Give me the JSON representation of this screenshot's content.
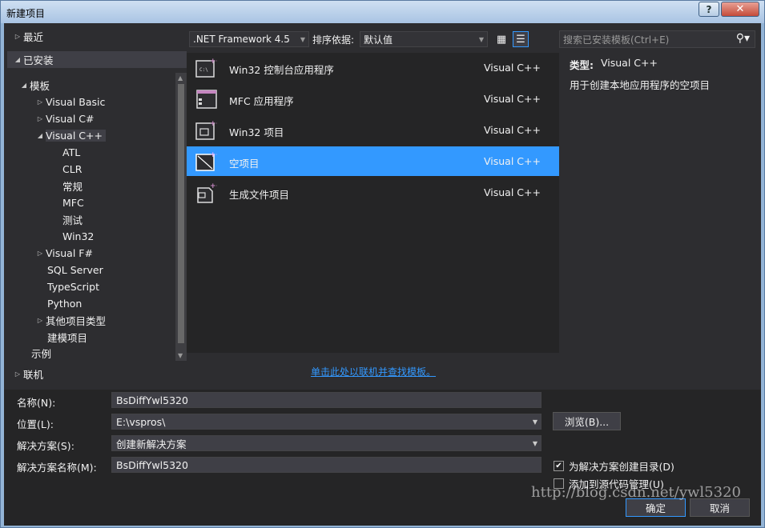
{
  "window": {
    "title": "新建项目",
    "help": "?",
    "close": "✕"
  },
  "nav": {
    "recent": "最近",
    "installed": "已安装",
    "templates": "模板",
    "items": [
      "Visual Basic",
      "Visual C#",
      "Visual C++"
    ],
    "cpp_children": [
      "ATL",
      "CLR",
      "常规",
      "MFC",
      "测试",
      "Win32"
    ],
    "items2": [
      "Visual F#",
      "SQL Server",
      "TypeScript",
      "Python",
      "其他项目类型",
      "建模项目"
    ],
    "samples": "示例",
    "online": "联机"
  },
  "toolbar": {
    "framework": ".NET Framework 4.5",
    "sort_label": "排序依据:",
    "sort_value": "默认值",
    "search_placeholder": "搜索已安装模板(Ctrl+E)"
  },
  "templates": [
    {
      "name": "Win32 控制台应用程序",
      "lang": "Visual C++",
      "icon": "console-app-icon"
    },
    {
      "name": "MFC 应用程序",
      "lang": "Visual C++",
      "icon": "mfc-app-icon"
    },
    {
      "name": "Win32 项目",
      "lang": "Visual C++",
      "icon": "win32-project-icon"
    },
    {
      "name": "空项目",
      "lang": "Visual C++",
      "icon": "empty-project-icon"
    },
    {
      "name": "生成文件项目",
      "lang": "Visual C++",
      "icon": "makefile-project-icon"
    }
  ],
  "online_link": "单击此处以联机并查找模板。",
  "detail": {
    "type_label": "类型:",
    "type_value": "Visual C++",
    "description": "用于创建本地应用程序的空项目"
  },
  "form": {
    "name_label": "名称(N):",
    "name_value": "BsDiffYwl5320",
    "location_label": "位置(L):",
    "location_value": "E:\\vspros\\",
    "solution_label": "解决方案(S):",
    "solution_value": "创建新解决方案",
    "solution_name_label": "解决方案名称(M):",
    "solution_name_value": "BsDiffYwl5320",
    "browse": "浏览(B)...",
    "create_dir": "为解决方案创建目录(D)",
    "add_source_control": "添加到源代码管理(U)",
    "ok": "确定",
    "cancel": "取消"
  },
  "watermark": "http://blog.csdn.net/ywl5320"
}
